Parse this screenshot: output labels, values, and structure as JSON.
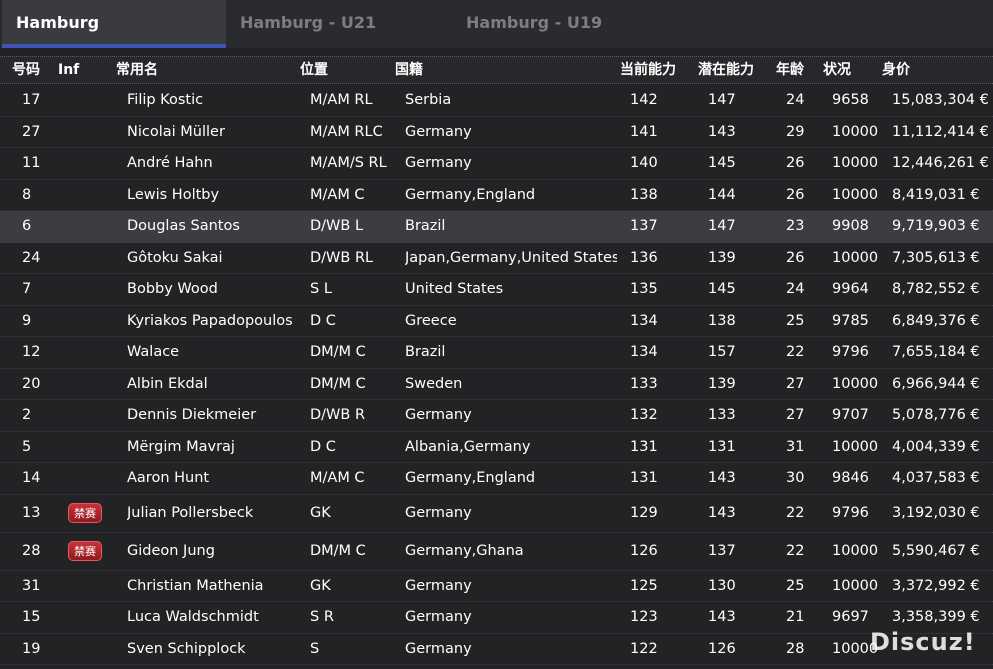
{
  "tabs": [
    {
      "label": "Hamburg",
      "active": true
    },
    {
      "label": "Hamburg - U21",
      "active": false
    },
    {
      "label": "Hamburg - U19",
      "active": false
    }
  ],
  "columns": {
    "num": "号码",
    "inf": "Inf",
    "name": "常用名",
    "pos": "位置",
    "nat": "国籍",
    "ca": "当前能力",
    "pa": "潜在能力",
    "age": "年龄",
    "cond": "状况",
    "value": "身价"
  },
  "players": [
    {
      "num": "17",
      "inf": "",
      "name": "Filip Kostic",
      "pos": "M/AM RL",
      "nat": "Serbia",
      "ca": "142",
      "pa": "147",
      "age": "24",
      "cond": "9658",
      "value": "15,083,304 €"
    },
    {
      "num": "27",
      "inf": "",
      "name": "Nicolai Müller",
      "pos": "M/AM RLC",
      "nat": "Germany",
      "ca": "141",
      "pa": "143",
      "age": "29",
      "cond": "10000",
      "value": "11,112,414 €"
    },
    {
      "num": "11",
      "inf": "",
      "name": "André Hahn",
      "pos": "M/AM/S RL",
      "nat": "Germany",
      "ca": "140",
      "pa": "145",
      "age": "26",
      "cond": "10000",
      "value": "12,446,261 €"
    },
    {
      "num": "8",
      "inf": "",
      "name": "Lewis Holtby",
      "pos": "M/AM C",
      "nat": "Germany,England",
      "ca": "138",
      "pa": "144",
      "age": "26",
      "cond": "10000",
      "value": "8,419,031 €"
    },
    {
      "num": "6",
      "inf": "",
      "name": "Douglas Santos",
      "pos": "D/WB L",
      "nat": "Brazil",
      "ca": "137",
      "pa": "147",
      "age": "23",
      "cond": "9908",
      "value": "9,719,903 €",
      "highlight": true
    },
    {
      "num": "24",
      "inf": "",
      "name": "Gôtoku Sakai",
      "pos": "D/WB RL",
      "nat": "Japan,Germany,United States",
      "ca": "136",
      "pa": "139",
      "age": "26",
      "cond": "10000",
      "value": "7,305,613 €"
    },
    {
      "num": "7",
      "inf": "",
      "name": "Bobby Wood",
      "pos": "S L",
      "nat": "United States",
      "ca": "135",
      "pa": "145",
      "age": "24",
      "cond": "9964",
      "value": "8,782,552 €"
    },
    {
      "num": "9",
      "inf": "",
      "name": "Kyriakos Papadopoulos",
      "pos": "D C",
      "nat": "Greece",
      "ca": "134",
      "pa": "138",
      "age": "25",
      "cond": "9785",
      "value": "6,849,376 €"
    },
    {
      "num": "12",
      "inf": "",
      "name": "Walace",
      "pos": "DM/M C",
      "nat": "Brazil",
      "ca": "134",
      "pa": "157",
      "age": "22",
      "cond": "9796",
      "value": "7,655,184 €"
    },
    {
      "num": "20",
      "inf": "",
      "name": "Albin Ekdal",
      "pos": "DM/M C",
      "nat": "Sweden",
      "ca": "133",
      "pa": "139",
      "age": "27",
      "cond": "10000",
      "value": "6,966,944 €"
    },
    {
      "num": "2",
      "inf": "",
      "name": "Dennis Diekmeier",
      "pos": "D/WB R",
      "nat": "Germany",
      "ca": "132",
      "pa": "133",
      "age": "27",
      "cond": "9707",
      "value": "5,078,776 €"
    },
    {
      "num": "5",
      "inf": "",
      "name": "Mërgim Mavraj",
      "pos": "D C",
      "nat": "Albania,Germany",
      "ca": "131",
      "pa": "131",
      "age": "31",
      "cond": "10000",
      "value": "4,004,339 €"
    },
    {
      "num": "14",
      "inf": "",
      "name": "Aaron Hunt",
      "pos": "M/AM C",
      "nat": "Germany,England",
      "ca": "131",
      "pa": "143",
      "age": "30",
      "cond": "9846",
      "value": "4,037,583 €"
    },
    {
      "num": "13",
      "inf": "禁赛",
      "name": "Julian Pollersbeck",
      "pos": "GK",
      "nat": "Germany",
      "ca": "129",
      "pa": "143",
      "age": "22",
      "cond": "9796",
      "value": "3,192,030 €"
    },
    {
      "num": "28",
      "inf": "禁赛",
      "name": "Gideon Jung",
      "pos": "DM/M C",
      "nat": "Germany,Ghana",
      "ca": "126",
      "pa": "137",
      "age": "22",
      "cond": "10000",
      "value": "5,590,467 €"
    },
    {
      "num": "31",
      "inf": "",
      "name": "Christian Mathenia",
      "pos": "GK",
      "nat": "Germany",
      "ca": "125",
      "pa": "130",
      "age": "25",
      "cond": "10000",
      "value": "3,372,992 €"
    },
    {
      "num": "15",
      "inf": "",
      "name": "Luca Waldschmidt",
      "pos": "S R",
      "nat": "Germany",
      "ca": "123",
      "pa": "143",
      "age": "21",
      "cond": "9697",
      "value": "3,358,399 €"
    },
    {
      "num": "19",
      "inf": "",
      "name": "Sven Schipplock",
      "pos": "S",
      "nat": "Germany",
      "ca": "122",
      "pa": "126",
      "age": "28",
      "cond": "10000",
      "value": ""
    }
  ],
  "watermark": "Discuz!"
}
